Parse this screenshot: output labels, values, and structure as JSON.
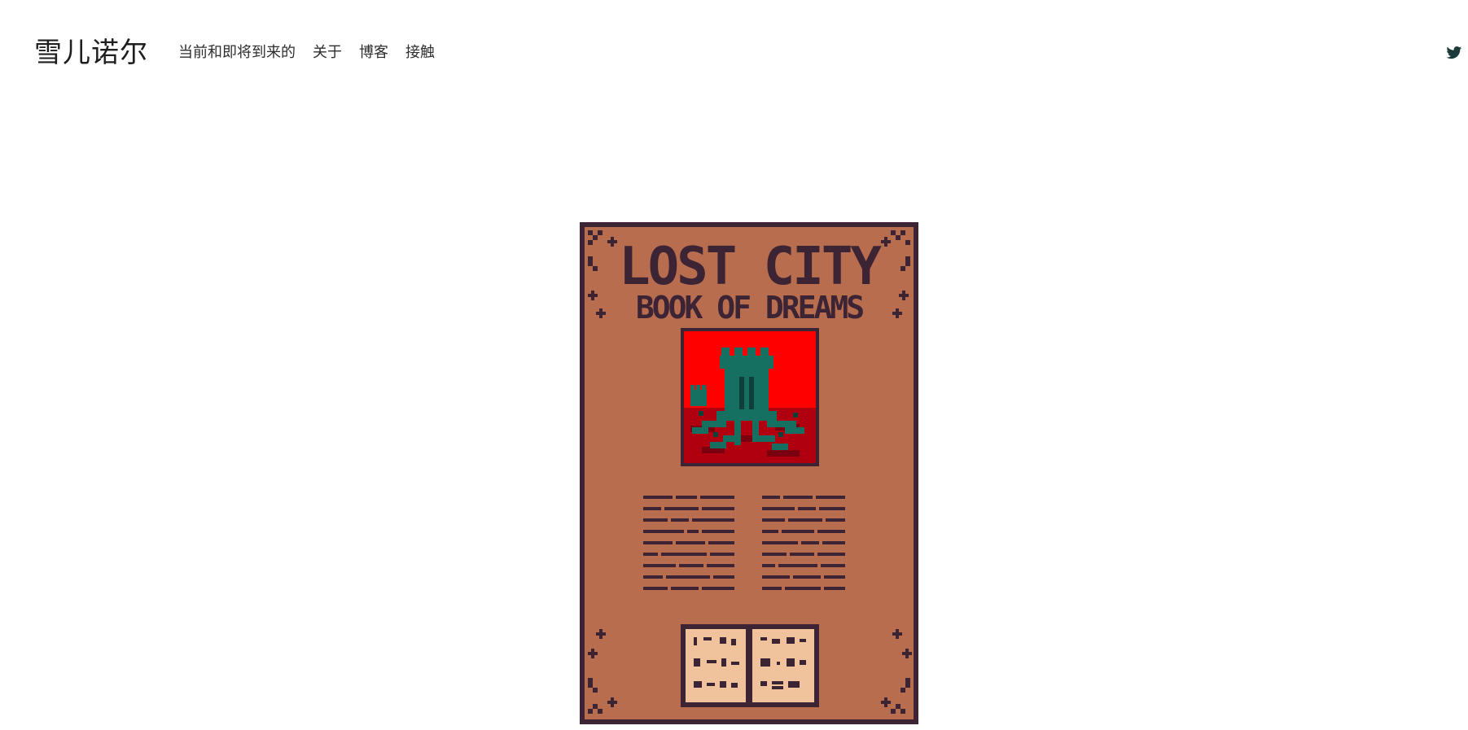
{
  "site": {
    "title": "雪儿诺尔"
  },
  "nav": {
    "items": [
      {
        "label": "当前和即将到来的"
      },
      {
        "label": "关于"
      },
      {
        "label": "博客"
      },
      {
        "label": "接触"
      }
    ]
  },
  "social": {
    "icon": "twitter-icon"
  },
  "cover": {
    "title_line1": "LOST CITY",
    "title_line2": "BOOK OF DREAMS",
    "colors": {
      "background": "#b86e4e",
      "border": "#3d2435",
      "sky": "#ff0000",
      "ground": "#b00010",
      "tower": "#157062",
      "pages": "#f0c39d"
    }
  }
}
